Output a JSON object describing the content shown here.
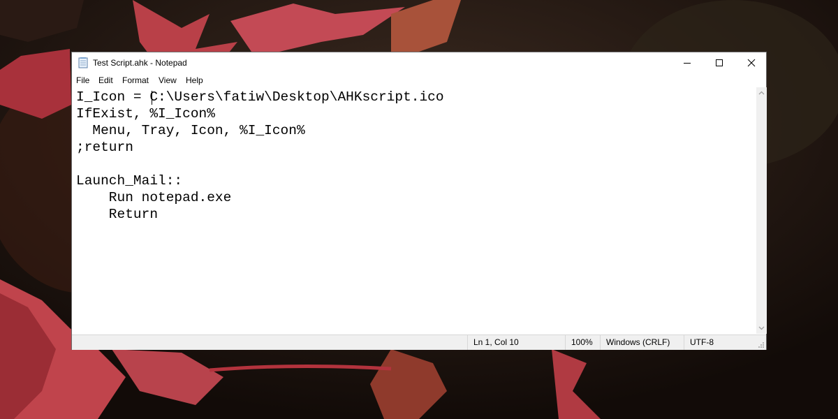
{
  "window": {
    "title": "Test Script.ahk - Notepad",
    "icon": "notepad-icon"
  },
  "caption_buttons": [
    {
      "name": "minimize",
      "icon": "minimize-icon"
    },
    {
      "name": "maximize",
      "icon": "maximize-icon"
    },
    {
      "name": "close",
      "icon": "close-icon"
    }
  ],
  "menu": [
    "File",
    "Edit",
    "Format",
    "View",
    "Help"
  ],
  "editor": {
    "lines": [
      "I_Icon = C:\\Users\\fatiw\\Desktop\\AHKscript.ico",
      "IfExist, %I_Icon%",
      "  Menu, Tray, Icon, %I_Icon%",
      ";return",
      "",
      "Launch_Mail::",
      "    Run notepad.exe",
      "    Return"
    ]
  },
  "statusbar": {
    "position": "Ln 1, Col 10",
    "zoom": "100%",
    "line_endings": "Windows (CRLF)",
    "encoding": "UTF-8"
  },
  "colors": {
    "leaf": "#b83a45",
    "background": "#1a100c"
  }
}
